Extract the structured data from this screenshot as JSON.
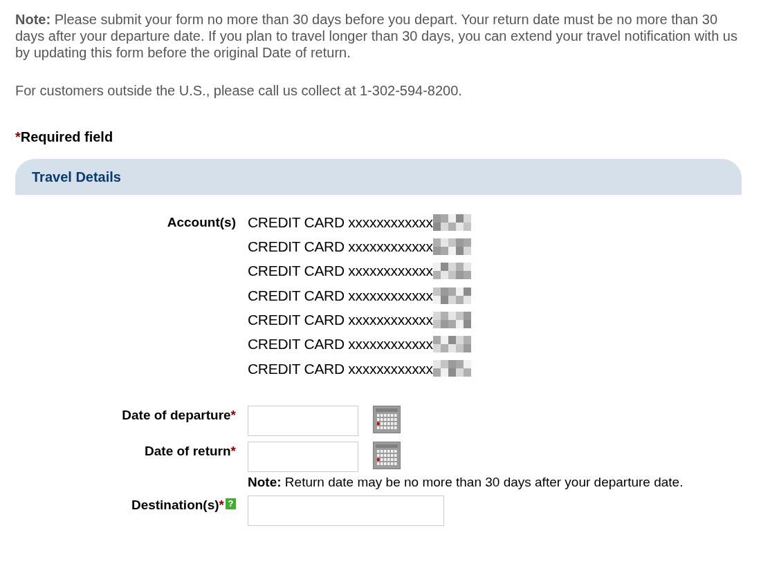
{
  "intro_note": "**Note:** Please submit your form no more than 30 days before you depart. Your return date must be no more than 30 days after your departure date. If you plan to travel longer than 30 days, you can extend your travel notification with us by updating this form before the original Date of return.",
  "contact_note": "For customers outside the U.S., please call us collect at 1-302-594-8200.",
  "required_legend": {
    "mark": "*",
    "text": "Required field"
  },
  "section": {
    "title": "Travel Details"
  },
  "accounts": {
    "label": "Account(s)",
    "items": [
      "CREDIT CARD xxxxxxxxxxxx",
      "CREDIT CARD xxxxxxxxxxxx",
      "CREDIT CARD xxxxxxxxxxxx",
      "CREDIT CARD xxxxxxxxxxxx",
      "CREDIT CARD xxxxxxxxxxxx",
      "CREDIT CARD xxxxxxxxxxxx",
      "CREDIT CARD xxxxxxxxxxxx"
    ]
  },
  "fields": [
    {
      "kind": "date",
      "label": "Date of departure",
      "mark": "*"
    },
    {
      "kind": "date",
      "label": "Date of return",
      "mark": "*",
      "note": "**Note:** Return date may be no more than 30 days after your departure date."
    },
    {
      "kind": "text",
      "label": "Destination(s)",
      "mark": "*",
      "help": "?"
    }
  ]
}
